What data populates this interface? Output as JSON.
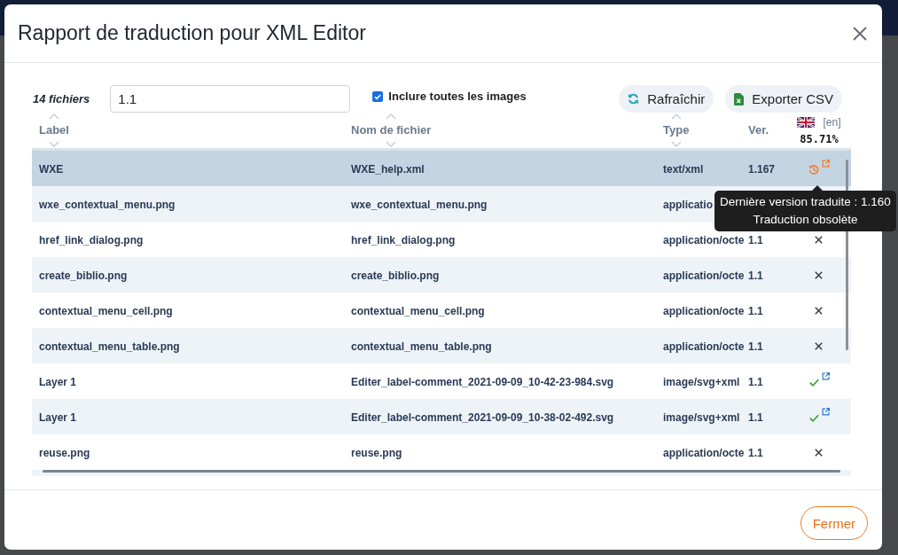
{
  "dialog": {
    "title": "Rapport de traduction pour XML Editor"
  },
  "toolbar": {
    "file_count": "14 fichiers",
    "filter": {
      "value": "1.1"
    },
    "include_images": {
      "label": "Inclure toutes les images",
      "checked": true
    },
    "buttons": [
      {
        "kind": "refresh",
        "label": "Rafraîchir"
      },
      {
        "kind": "export",
        "label": "Exporter CSV"
      }
    ]
  },
  "table": {
    "columns": [
      {
        "kind": "text",
        "label": "Label",
        "sortable": true
      },
      {
        "kind": "text",
        "label": "Nom de fichier",
        "sortable": true
      },
      {
        "kind": "text",
        "label": "Type",
        "sortable": true
      },
      {
        "kind": "text",
        "label": "Ver.",
        "sortable": false
      },
      {
        "kind": "language",
        "code": "[en]",
        "percentage": "85.71%"
      }
    ],
    "rows": [
      {
        "label": "WXE",
        "file": "WXE_help.xml",
        "type": "text/xml",
        "version": "1.167",
        "outdated": true,
        "link": true,
        "selected": true
      },
      {
        "label": "wxe_contextual_menu.png",
        "file": "wxe_contextual_menu.png",
        "type": "applicatio",
        "selected": false
      },
      {
        "label": "href_link_dialog.png",
        "file": "href_link_dialog.png",
        "type": "application/octe",
        "version": "1.1",
        "translated": false,
        "outdated": false,
        "link": false,
        "selected": false
      },
      {
        "label": "create_biblio.png",
        "file": "create_biblio.png",
        "type": "application/octe",
        "version": "1.1",
        "translated": false,
        "outdated": false,
        "link": false,
        "selected": false
      },
      {
        "label": "contextual_menu_cell.png",
        "file": "contextual_menu_cell.png",
        "type": "application/octe",
        "version": "1.1",
        "translated": false,
        "outdated": false,
        "link": false,
        "selected": false
      },
      {
        "label": "contextual_menu_table.png",
        "file": "contextual_menu_table.png",
        "type": "application/octe",
        "version": "1.1",
        "translated": false,
        "outdated": false,
        "link": false,
        "selected": false
      },
      {
        "label": "Layer 1",
        "file": "Editer_label-comment_2021-09-09_10-42-23-984.svg",
        "type": "image/svg+xml",
        "version": "1.1",
        "translated": true,
        "outdated": false,
        "link": true,
        "selected": false
      },
      {
        "label": "Layer 1",
        "file": "Editer_label-comment_2021-09-09_10-38-02-492.svg",
        "type": "image/svg+xml",
        "version": "1.1",
        "translated": true,
        "outdated": false,
        "link": true,
        "selected": false
      },
      {
        "label": "reuse.png",
        "file": "reuse.png",
        "type": "application/octe",
        "version": "1.1",
        "translated": false,
        "outdated": false,
        "link": false,
        "selected": false
      }
    ]
  },
  "tooltip": {
    "lines": [
      "Dernière version traduite : 1.160",
      "Traduction obsolète"
    ]
  },
  "footer": {
    "close_button": {
      "label": "Fermer"
    }
  }
}
